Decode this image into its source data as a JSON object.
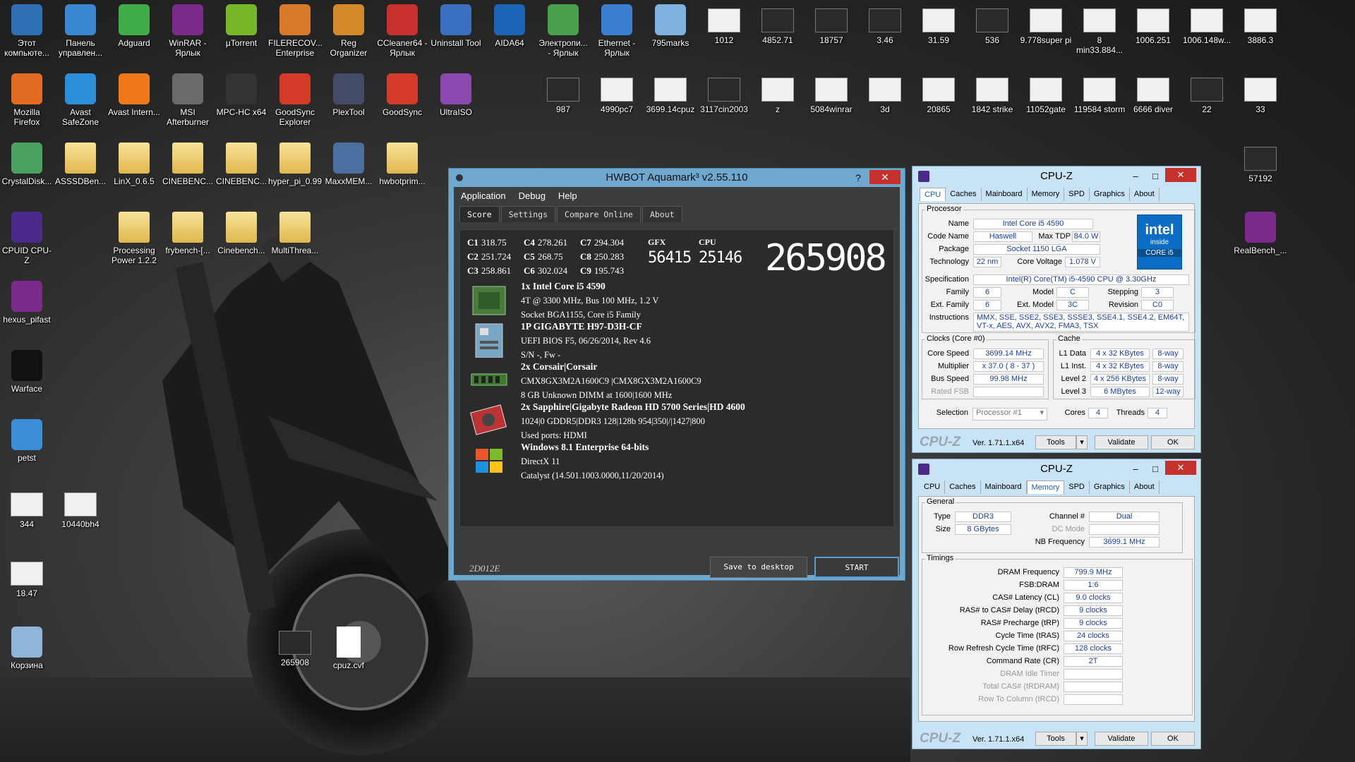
{
  "desktop": {
    "icons": [
      {
        "label": "Этот компьюте...",
        "icon": "computer-icon",
        "col": 0,
        "row": 0,
        "color": "#2f6fb5"
      },
      {
        "label": "Панель управлен...",
        "icon": "control-panel-icon",
        "col": 1,
        "row": 0,
        "color": "#3b86d1"
      },
      {
        "label": "Adguard",
        "icon": "adguard-icon",
        "col": 2,
        "row": 0,
        "color": "#3fae49"
      },
      {
        "label": "WinRAR - Ярлык",
        "icon": "winrar-icon",
        "col": 3,
        "row": 0,
        "color": "#7b2c8a"
      },
      {
        "label": "µTorrent",
        "icon": "utorrent-icon",
        "col": 4,
        "row": 0,
        "color": "#77b82a"
      },
      {
        "label": "FILERECOV... Enterprise",
        "icon": "filerecovery-icon",
        "col": 5,
        "row": 0,
        "color": "#d97a2b"
      },
      {
        "label": "Reg Organizer",
        "icon": "reg-organizer-icon",
        "col": 6,
        "row": 0,
        "color": "#d48a2a"
      },
      {
        "label": "CCleaner64 - Ярлык",
        "icon": "ccleaner-icon",
        "col": 7,
        "row": 0,
        "color": "#c83030"
      },
      {
        "label": "Uninstall Tool",
        "icon": "uninstall-tool-icon",
        "col": 8,
        "row": 0,
        "color": "#3a6fc0"
      },
      {
        "label": "AIDA64",
        "icon": "aida64-icon",
        "col": 9,
        "row": 0,
        "color": "#1c64b8"
      },
      {
        "label": "Электропи... - Ярлык",
        "icon": "battery-icon",
        "col": 10,
        "row": 0,
        "color": "#4aa04a"
      },
      {
        "label": "Ethernet - Ярлык",
        "icon": "network-icon",
        "col": 11,
        "row": 0,
        "color": "#3a7fd0"
      },
      {
        "label": "795marks",
        "icon": "document-icon",
        "col": 12,
        "row": 0,
        "color": "#7fb3e0"
      },
      {
        "label": "Mozilla Firefox",
        "icon": "firefox-icon",
        "col": 0,
        "row": 1,
        "color": "#e36b22"
      },
      {
        "label": "Avast SafeZone",
        "icon": "avast-safezone-icon",
        "col": 1,
        "row": 1,
        "color": "#2a8fd6"
      },
      {
        "label": "Avast Intern...",
        "icon": "avast-icon",
        "col": 2,
        "row": 1,
        "color": "#f07a1a"
      },
      {
        "label": "MSI Afterburner",
        "icon": "afterburner-icon",
        "col": 3,
        "row": 1,
        "color": "#6a6a6a"
      },
      {
        "label": "MPC-HC x64",
        "icon": "mpc-hc-icon",
        "col": 4,
        "row": 1,
        "color": "#333333"
      },
      {
        "label": "GoodSync Explorer",
        "icon": "goodsync-explorer-icon",
        "col": 5,
        "row": 1,
        "color": "#d43a2a"
      },
      {
        "label": "PlexTool",
        "icon": "plextool-icon",
        "col": 6,
        "row": 1,
        "color": "#444b66"
      },
      {
        "label": "GoodSync",
        "icon": "goodsync-icon",
        "col": 7,
        "row": 1,
        "color": "#d43a2a"
      },
      {
        "label": "UltraISO",
        "icon": "ultraiso-icon",
        "col": 8,
        "row": 1,
        "color": "#8a4ab0"
      },
      {
        "label": "CrystalDisk...",
        "icon": "crystaldisk-icon",
        "col": 0,
        "row": 2,
        "color": "#4aa060"
      },
      {
        "label": "ASSSDBen...",
        "icon": "folder-icon",
        "col": 1,
        "row": 2,
        "color": "folder"
      },
      {
        "label": "LinX_0.6.5",
        "icon": "folder-icon",
        "col": 2,
        "row": 2,
        "color": "folder"
      },
      {
        "label": "CINEBENC...",
        "icon": "folder-icon",
        "col": 3,
        "row": 2,
        "color": "folder"
      },
      {
        "label": "CINEBENC...",
        "icon": "folder-icon",
        "col": 4,
        "row": 2,
        "color": "folder"
      },
      {
        "label": "hyper_pi_0.99",
        "icon": "folder-icon",
        "col": 5,
        "row": 2,
        "color": "folder"
      },
      {
        "label": "MaxxMEM...",
        "icon": "maxxmem-icon",
        "col": 6,
        "row": 2,
        "color": "#4a6fa0"
      },
      {
        "label": "hwbotprim...",
        "icon": "folder-icon",
        "col": 7,
        "row": 2,
        "color": "folder"
      },
      {
        "label": "CPUID CPU-Z",
        "icon": "cpuz-icon",
        "col": 0,
        "row": 3,
        "color": "#4a2b8c"
      },
      {
        "label": "Processing Power 1.2.2",
        "icon": "folder-icon",
        "col": 2,
        "row": 3,
        "color": "folder"
      },
      {
        "label": "frybench-[...",
        "icon": "folder-icon",
        "col": 3,
        "row": 3,
        "color": "folder"
      },
      {
        "label": "Cinebench...",
        "icon": "folder-icon",
        "col": 4,
        "row": 3,
        "color": "folder"
      },
      {
        "label": "MultiThrea...",
        "icon": "folder-icon",
        "col": 5,
        "row": 3,
        "color": "folder"
      },
      {
        "label": "hexus_pifast",
        "icon": "winrar-icon",
        "col": 0,
        "row": 4,
        "color": "#7b2c8a"
      },
      {
        "label": "Warface",
        "icon": "warface-icon",
        "col": 0,
        "row": 5,
        "color": "#111111"
      },
      {
        "label": "petst",
        "icon": "petst-icon",
        "col": 0,
        "row": 6,
        "color": "#3a8fd6"
      },
      {
        "label": "344",
        "icon": "image-thumb-icon",
        "col": 0,
        "row": 7,
        "color": "thumb"
      },
      {
        "label": "10440bh4",
        "icon": "image-thumb-icon",
        "col": 1,
        "row": 7,
        "color": "thumb"
      },
      {
        "label": "18.47",
        "icon": "image-thumb-icon",
        "col": 0,
        "row": 8,
        "color": "thumb"
      },
      {
        "label": "Корзина",
        "icon": "recycle-bin-icon",
        "col": 0,
        "row": 9,
        "color": "#8fb6d8"
      },
      {
        "label": "265908",
        "icon": "image-thumb-icon",
        "col": 5,
        "row": 9,
        "color": "thumbd"
      },
      {
        "label": "cpuz.cvf",
        "icon": "file-icon",
        "col": 6,
        "row": 9,
        "color": "file"
      },
      {
        "label": "1012",
        "icon": "image-thumb-icon",
        "col": 13,
        "row": 0,
        "color": "thumb"
      },
      {
        "label": "4852.71",
        "icon": "image-thumb-icon",
        "col": 14,
        "row": 0,
        "color": "thumbd"
      },
      {
        "label": "18757",
        "icon": "image-thumb-icon",
        "col": 15,
        "row": 0,
        "color": "thumbd"
      },
      {
        "label": "3.46",
        "icon": "image-thumb-icon",
        "col": 16,
        "row": 0,
        "color": "thumbd"
      },
      {
        "label": "31.59",
        "icon": "image-thumb-icon",
        "col": 17,
        "row": 0,
        "color": "thumb"
      },
      {
        "label": "536",
        "icon": "image-thumb-icon",
        "col": 18,
        "row": 0,
        "color": "thumbd"
      },
      {
        "label": "9.778super pi",
        "icon": "image-thumb-icon",
        "col": 19,
        "row": 0,
        "color": "thumb"
      },
      {
        "label": "8 min33.884...",
        "icon": "image-thumb-icon",
        "col": 20,
        "row": 0,
        "color": "thumb"
      },
      {
        "label": "1006.251",
        "icon": "image-thumb-icon",
        "col": 21,
        "row": 0,
        "color": "thumb"
      },
      {
        "label": "1006.148w...",
        "icon": "image-thumb-icon",
        "col": 22,
        "row": 0,
        "color": "thumb"
      },
      {
        "label": "3886.3",
        "icon": "image-thumb-icon",
        "col": 23,
        "row": 0,
        "color": "thumb"
      },
      {
        "label": "987",
        "icon": "image-thumb-icon",
        "col": 10,
        "row": 1,
        "color": "thumbd"
      },
      {
        "label": "4990pc7",
        "icon": "image-thumb-icon",
        "col": 11,
        "row": 1,
        "color": "thumb"
      },
      {
        "label": "3699.14cpuz",
        "icon": "image-thumb-icon",
        "col": 12,
        "row": 1,
        "color": "thumb"
      },
      {
        "label": "3117cin2003",
        "icon": "image-thumb-icon",
        "col": 13,
        "row": 1,
        "color": "thumbd"
      },
      {
        "label": "z",
        "icon": "image-thumb-icon",
        "col": 14,
        "row": 1,
        "color": "thumb"
      },
      {
        "label": "5084winrar",
        "icon": "image-thumb-icon",
        "col": 15,
        "row": 1,
        "color": "thumb"
      },
      {
        "label": "3d",
        "icon": "image-thumb-icon",
        "col": 16,
        "row": 1,
        "color": "thumb"
      },
      {
        "label": "20865",
        "icon": "image-thumb-icon",
        "col": 17,
        "row": 1,
        "color": "thumb"
      },
      {
        "label": "1842 strike",
        "icon": "image-thumb-icon",
        "col": 18,
        "row": 1,
        "color": "thumb"
      },
      {
        "label": "11052gate",
        "icon": "image-thumb-icon",
        "col": 19,
        "row": 1,
        "color": "thumb"
      },
      {
        "label": "119584 storm",
        "icon": "image-thumb-icon",
        "col": 20,
        "row": 1,
        "color": "thumb"
      },
      {
        "label": "6666 diver",
        "icon": "image-thumb-icon",
        "col": 21,
        "row": 1,
        "color": "thumb"
      },
      {
        "label": "22",
        "icon": "image-thumb-icon",
        "col": 22,
        "row": 1,
        "color": "thumbd"
      },
      {
        "label": "33",
        "icon": "image-thumb-icon",
        "col": 23,
        "row": 1,
        "color": "thumb"
      },
      {
        "label": "57192",
        "icon": "image-thumb-icon",
        "col": 23,
        "row": 2,
        "color": "thumbd"
      },
      {
        "label": "RealBench_...",
        "icon": "winrar-icon",
        "col": 23,
        "row": 3,
        "color": "#7b2c8a"
      }
    ]
  },
  "hwbot": {
    "title": "HWBOT Aquamark³ v2.55.110",
    "help": "?",
    "close": "✕",
    "menu": [
      "Application",
      "Debug",
      "Help"
    ],
    "tabs": [
      "Score",
      "Settings",
      "Compare Online",
      "About"
    ],
    "scores": [
      [
        {
          "k": "C1",
          "v": "318.75"
        },
        {
          "k": "C4",
          "v": "278.261"
        },
        {
          "k": "C7",
          "v": "294.304"
        }
      ],
      [
        {
          "k": "C2",
          "v": "251.724"
        },
        {
          "k": "C5",
          "v": "268.75"
        },
        {
          "k": "C8",
          "v": "250.283"
        }
      ],
      [
        {
          "k": "C3",
          "v": "258.861"
        },
        {
          "k": "C6",
          "v": "302.024"
        },
        {
          "k": "C9",
          "v": "195.743"
        }
      ]
    ],
    "gfx_label": "GFX",
    "gfx_value": "56415",
    "cpu_label": "CPU",
    "cpu_value": "25146",
    "total": "265908",
    "specs": [
      {
        "icon": "cpu-chip-icon",
        "title": "1x Intel Core i5 4590",
        "lines": [
          "4T @ 3300 MHz, Bus 100 MHz, 1.2 V",
          "Socket BGA1155, Core i5 Family"
        ]
      },
      {
        "icon": "motherboard-icon",
        "title": "1P GIGABYTE H97-D3H-CF",
        "lines": [
          "UEFI BIOS F5, 06/26/2014, Rev 4.6",
          "S/N -, Fw -"
        ]
      },
      {
        "icon": "memory-module-icon",
        "title": "2x Corsair|Corsair",
        "lines": [
          "CMX8GX3M2A1600C9 |CMX8GX3M2A1600C9",
          "8 GB Unknown DIMM at 1600|1600 MHz"
        ]
      },
      {
        "icon": "graphics-card-icon",
        "title": "2x Sapphire|Gigabyte Radeon HD 5700 Series|HD  4600",
        "lines": [
          "1024|0 GDDR5|DDR3 128|128b 954|350|/|1427|800",
          "Used ports: HDMI"
        ]
      },
      {
        "icon": "windows-logo-icon",
        "title": "Windows 8.1 Enterprise 64-bits",
        "lines": [
          "DirectX 11",
          "Catalyst (14.501.1003.0000,11/20/2014)"
        ]
      }
    ],
    "code": "2D012E",
    "save_label": "Save to desktop",
    "start_label": "START"
  },
  "cpuz1": {
    "title": "CPU-Z",
    "tabs": [
      "CPU",
      "Caches",
      "Mainboard",
      "Memory",
      "SPD",
      "Graphics",
      "About"
    ],
    "active_tab": "CPU",
    "processor_group": "Processor",
    "name_lbl": "Name",
    "name": "Intel Core i5 4590",
    "codename_lbl": "Code Name",
    "codename": "Haswell",
    "tdp_lbl": "Max TDP",
    "tdp": "84.0 W",
    "package_lbl": "Package",
    "package": "Socket 1150 LGA",
    "tech_lbl": "Technology",
    "tech": "22 nm",
    "voltage_lbl": "Core Voltage",
    "voltage": "1.078 V",
    "spec_lbl": "Specification",
    "spec": "Intel(R) Core(TM) i5-4590 CPU @ 3.30GHz",
    "family_lbl": "Family",
    "family": "6",
    "model_lbl": "Model",
    "model": "C",
    "stepping_lbl": "Stepping",
    "stepping": "3",
    "extfamily_lbl": "Ext. Family",
    "extfamily": "6",
    "extmodel_lbl": "Ext. Model",
    "extmodel": "3C",
    "revision_lbl": "Revision",
    "revision": "C0",
    "instr_lbl": "Instructions",
    "instr1": "MMX, SSE, SSE2, SSE3, SSSE3, SSE4.1, SSE4.2, EM64T,",
    "instr2": "VT-x, AES, AVX, AVX2, FMA3, TSX",
    "clocks_group": "Clocks (Core #0)",
    "corespeed_lbl": "Core Speed",
    "corespeed": "3699.14 MHz",
    "mult_lbl": "Multiplier",
    "mult": "x 37.0 ( 8 - 37 )",
    "bus_lbl": "Bus Speed",
    "bus": "99.98 MHz",
    "fsb_lbl": "Rated FSB",
    "cache_group": "Cache",
    "l1d_lbl": "L1 Data",
    "l1d": "4 x 32 KBytes",
    "l1d_way": "8-way",
    "l1i_lbl": "L1 Inst.",
    "l1i": "4 x 32 KBytes",
    "l1i_way": "8-way",
    "l2_lbl": "Level 2",
    "l2": "4 x 256 KBytes",
    "l2_way": "8-way",
    "l3_lbl": "Level 3",
    "l3": "6 MBytes",
    "l3_way": "12-way",
    "selection_lbl": "Selection",
    "selection": "Processor #1",
    "cores_lbl": "Cores",
    "cores": "4",
    "threads_lbl": "Threads",
    "threads": "4",
    "intel_line1": "intel",
    "intel_line2": "inside",
    "intel_line3": "CORE i5",
    "logo": "CPU-Z",
    "version": "Ver. 1.71.1.x64",
    "tools": "Tools",
    "validate": "Validate",
    "ok": "OK"
  },
  "cpuz2": {
    "title": "CPU-Z",
    "tabs": [
      "CPU",
      "Caches",
      "Mainboard",
      "Memory",
      "SPD",
      "Graphics",
      "About"
    ],
    "active_tab": "Memory",
    "general_group": "General",
    "type_lbl": "Type",
    "type": "DDR3",
    "size_lbl": "Size",
    "size": "8 GBytes",
    "channel_lbl": "Channel #",
    "channel": "Dual",
    "dcmode_lbl": "DC Mode",
    "nbfreq_lbl": "NB Frequency",
    "nbfreq": "3699.1 MHz",
    "timings_group": "Timings",
    "timings": [
      {
        "k": "DRAM Frequency",
        "v": "799.9 MHz",
        "gray": false
      },
      {
        "k": "FSB:DRAM",
        "v": "1:6",
        "gray": false
      },
      {
        "k": "CAS# Latency (CL)",
        "v": "9.0 clocks",
        "gray": false
      },
      {
        "k": "RAS# to CAS# Delay (tRCD)",
        "v": "9 clocks",
        "gray": false
      },
      {
        "k": "RAS# Precharge (tRP)",
        "v": "9 clocks",
        "gray": false
      },
      {
        "k": "Cycle Time (tRAS)",
        "v": "24 clocks",
        "gray": false
      },
      {
        "k": "Row Refresh Cycle Time (tRFC)",
        "v": "128 clocks",
        "gray": false
      },
      {
        "k": "Command Rate (CR)",
        "v": "2T",
        "gray": false
      },
      {
        "k": "DRAM Idle Timer",
        "v": "",
        "gray": true
      },
      {
        "k": "Total CAS# (tRDRAM)",
        "v": "",
        "gray": true
      },
      {
        "k": "Row To Column (tRCD)",
        "v": "",
        "gray": true
      }
    ],
    "logo": "CPU-Z",
    "version": "Ver. 1.71.1.x64",
    "tools": "Tools",
    "validate": "Validate",
    "ok": "OK"
  }
}
